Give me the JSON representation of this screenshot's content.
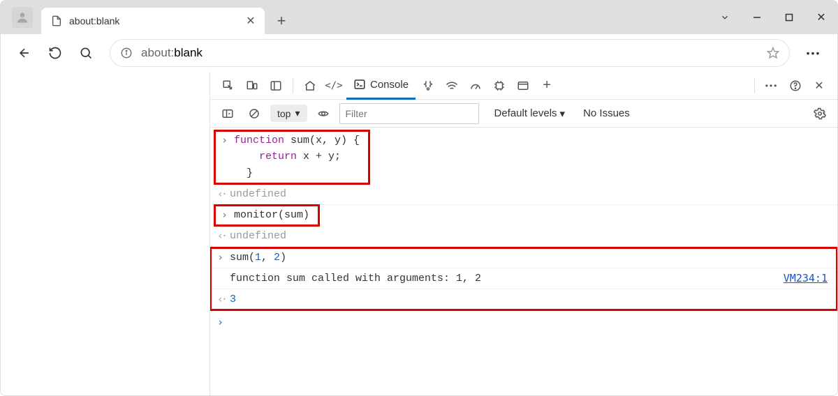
{
  "tab": {
    "title": "about:blank"
  },
  "url": {
    "scheme": "about:",
    "rest": "blank"
  },
  "devtools": {
    "tabs": {
      "console": "Console"
    },
    "console_bar": {
      "context": "top",
      "filter_placeholder": "Filter",
      "levels": "Default levels",
      "issues": "No Issues"
    }
  },
  "console": {
    "rows": [
      {
        "kind": "in",
        "code_html": "<span class='kw'>function</span> <span class='fn'>sum</span>(x, y) {\n    <span class='kw'>return</span> x + y;\n  }",
        "highlight": true
      },
      {
        "kind": "out",
        "text": "undefined",
        "class": "undef"
      },
      {
        "kind": "in",
        "code_html": "monitor(sum)",
        "highlight": true
      },
      {
        "kind": "out",
        "text": "undefined",
        "class": "undef"
      },
      {
        "kind": "in",
        "code_html": "sum(<span class='num'>1</span>, <span class='num'>2</span>)",
        "highlight": true,
        "hl_group_start": true
      },
      {
        "kind": "msg",
        "text": "function sum called with arguments: 1, 2",
        "link": "VM234:1",
        "highlight": true
      },
      {
        "kind": "out",
        "code_html": "<span class='result-num'>3</span>",
        "highlight": true,
        "hl_group_end": true
      }
    ]
  }
}
